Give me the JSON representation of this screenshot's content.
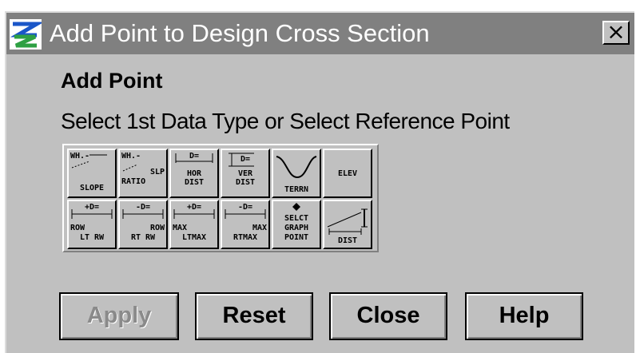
{
  "window": {
    "title": "Add Point to Design Cross Section",
    "close_label": "×"
  },
  "heading": "Add Point",
  "instruction": "Select 1st Data Type or Select Reference Point",
  "palette": {
    "row1": [
      {
        "name": "slope",
        "lines": [
          "WH.-",
          "",
          "SLOPE"
        ]
      },
      {
        "name": "slope-ratio",
        "lines": [
          "WH.-",
          "SLP",
          "RATIO"
        ]
      },
      {
        "name": "horizontal-distance",
        "lines": [
          "D=",
          "HOR",
          "DIST"
        ]
      },
      {
        "name": "vertical-distance",
        "lines": [
          "D=",
          "VER",
          "DIST"
        ]
      },
      {
        "name": "terrain",
        "lines": [
          "TERRN"
        ]
      },
      {
        "name": "elevation",
        "lines": [
          "ELEV"
        ]
      }
    ],
    "row2": [
      {
        "name": "row-lt-rw",
        "lines": [
          "+D=",
          "ROW",
          "LT RW"
        ]
      },
      {
        "name": "row-rt-rw",
        "lines": [
          "-D=",
          "ROW",
          "RT RW"
        ]
      },
      {
        "name": "max-lt-max",
        "lines": [
          "+D=",
          "MAX",
          "LTMAX"
        ]
      },
      {
        "name": "max-rt-max",
        "lines": [
          "-D=",
          "MAX",
          "RTMAX"
        ]
      },
      {
        "name": "select-graph-point",
        "lines": [
          "SELCT",
          "GRAPH",
          "POINT"
        ]
      },
      {
        "name": "distance",
        "lines": [
          "DIST"
        ]
      }
    ]
  },
  "buttons": {
    "apply": "Apply",
    "reset": "Reset",
    "close": "Close",
    "help": "Help"
  }
}
